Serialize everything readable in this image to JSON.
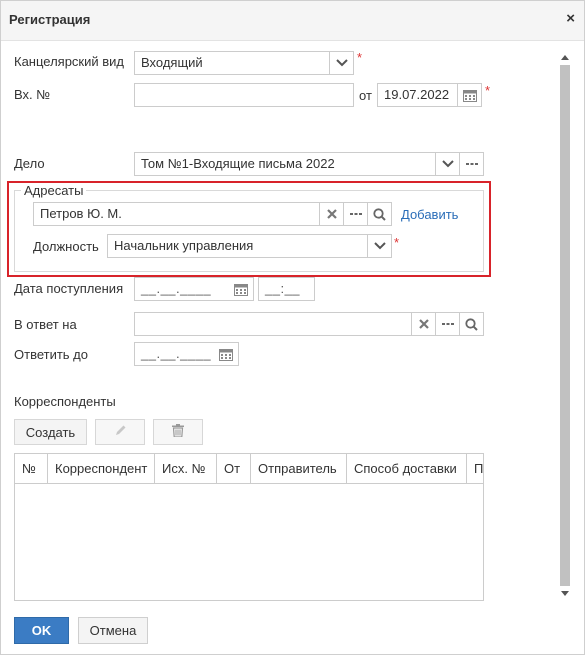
{
  "dialog": {
    "title": "Регистрация",
    "close_symbol": "×"
  },
  "form": {
    "office_type": {
      "label": "Канцелярский вид",
      "value": "Входящий",
      "required_mark": "*"
    },
    "incoming_number": {
      "label": "Вх. №",
      "value": "",
      "date_label": "от",
      "date_value": "19.07.2022",
      "required_mark": "*"
    },
    "case": {
      "label": "Дело",
      "value": "Том №1-Входящие письма 2022"
    },
    "addressees": {
      "legend": "Адресаты",
      "person": "Петров Ю. М.",
      "add_link": "Добавить",
      "position_label": "Должность",
      "position_value": "Начальник управления",
      "required_mark": "*"
    },
    "receipt_date": {
      "label": "Дата поступления",
      "date_placeholder": "__.__.____",
      "time_placeholder": "__:__"
    },
    "in_reply_to": {
      "label": "В ответ на",
      "value": ""
    },
    "reply_by": {
      "label": "Ответить до",
      "date_placeholder": "__.__.____"
    }
  },
  "correspondents": {
    "title": "Корреспонденты",
    "create_label": "Создать",
    "columns": [
      "№",
      "Корреспондент",
      "Исх. №",
      "От",
      "Отправитель",
      "Способ доставки",
      "П"
    ],
    "rows": []
  },
  "footer": {
    "ok_label": "OK",
    "cancel_label": "Отмена"
  },
  "colors": {
    "accent": "#3b7cc4",
    "highlight": "#d8232a",
    "required": "#dd3333",
    "link": "#2a6db8"
  },
  "icons": [
    "close-icon",
    "chevron-down-icon",
    "calendar-icon",
    "ellipsis-icon",
    "clear-icon",
    "search-icon",
    "pencil-icon",
    "trash-icon",
    "scroll-up-icon",
    "scroll-down-icon"
  ]
}
